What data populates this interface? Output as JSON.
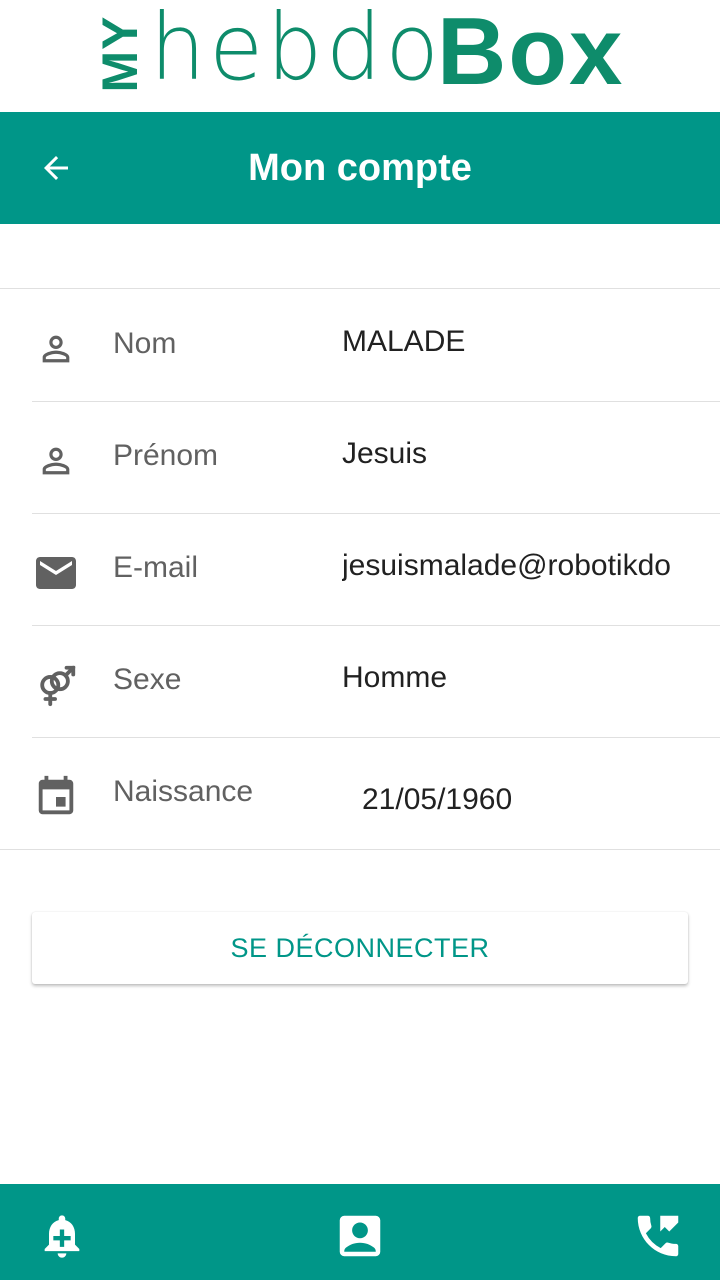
{
  "logo": {
    "prefix": "MY",
    "middle": "hebdo",
    "suffix": "Box",
    "color": "#0e8c6b"
  },
  "appbar": {
    "title": "Mon compte",
    "back_icon": "arrow-back-icon",
    "color": "#009688"
  },
  "profile": {
    "rows": [
      {
        "icon": "person-icon",
        "label": "Nom",
        "value": "MALADE"
      },
      {
        "icon": "person-icon",
        "label": "Prénom",
        "value": "Jesuis"
      },
      {
        "icon": "email-icon",
        "label": "E-mail",
        "value": "jesuismalade@robotikdo"
      },
      {
        "icon": "gender-icon",
        "label": "Sexe",
        "value": "Homme"
      },
      {
        "icon": "calendar-icon",
        "label": "Naissance",
        "value": "21/05/1960"
      }
    ]
  },
  "logout": {
    "label": "SE DÉCONNECTER"
  },
  "bottom_nav": {
    "items": [
      {
        "icon": "bell-plus-icon"
      },
      {
        "icon": "contact-card-icon"
      },
      {
        "icon": "phone-forward-icon"
      }
    ]
  }
}
